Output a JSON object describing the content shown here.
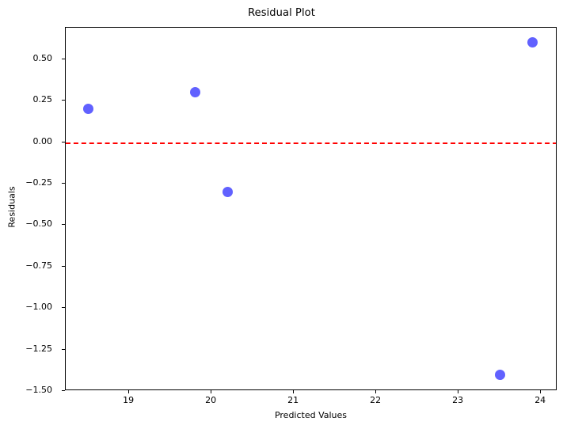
{
  "chart_data": {
    "type": "scatter",
    "title": "Residual Plot",
    "xlabel": "Predicted Values",
    "ylabel": "Residuals",
    "x": [
      18.5,
      19.8,
      20.2,
      23.5,
      23.9
    ],
    "y": [
      0.2,
      0.3,
      -0.3,
      -1.4,
      0.6
    ],
    "series": [
      {
        "name": "residuals",
        "marker": "circle",
        "color": "#0000ff",
        "alpha": 0.62,
        "points": [
          {
            "x": 18.5,
            "y": 0.2
          },
          {
            "x": 19.8,
            "y": 0.3
          },
          {
            "x": 20.2,
            "y": -0.3
          },
          {
            "x": 23.5,
            "y": -1.4
          },
          {
            "x": 23.9,
            "y": 0.6
          }
        ]
      }
    ],
    "reference_line": {
      "name": "zero-residual-line",
      "orientation": "horizontal",
      "value": 0.0,
      "color": "#ff0000",
      "style": "dashed"
    },
    "xlim": [
      18.23,
      24.2
    ],
    "ylim": [
      -1.5,
      0.69
    ],
    "xticks": [
      19,
      20,
      21,
      22,
      23,
      24
    ],
    "xticklabels": [
      "19",
      "20",
      "21",
      "22",
      "23",
      "24"
    ],
    "yticks": [
      0.5,
      0.25,
      0,
      -0.25,
      -0.5,
      -0.75,
      -1.0,
      -1.25,
      -1.5
    ],
    "yticklabels": [
      "0.50",
      "0.25",
      "0.00",
      "−0.25",
      "−0.50",
      "−0.75",
      "−1.00",
      "−1.25",
      "−1.50"
    ],
    "grid": false,
    "legend": false
  }
}
